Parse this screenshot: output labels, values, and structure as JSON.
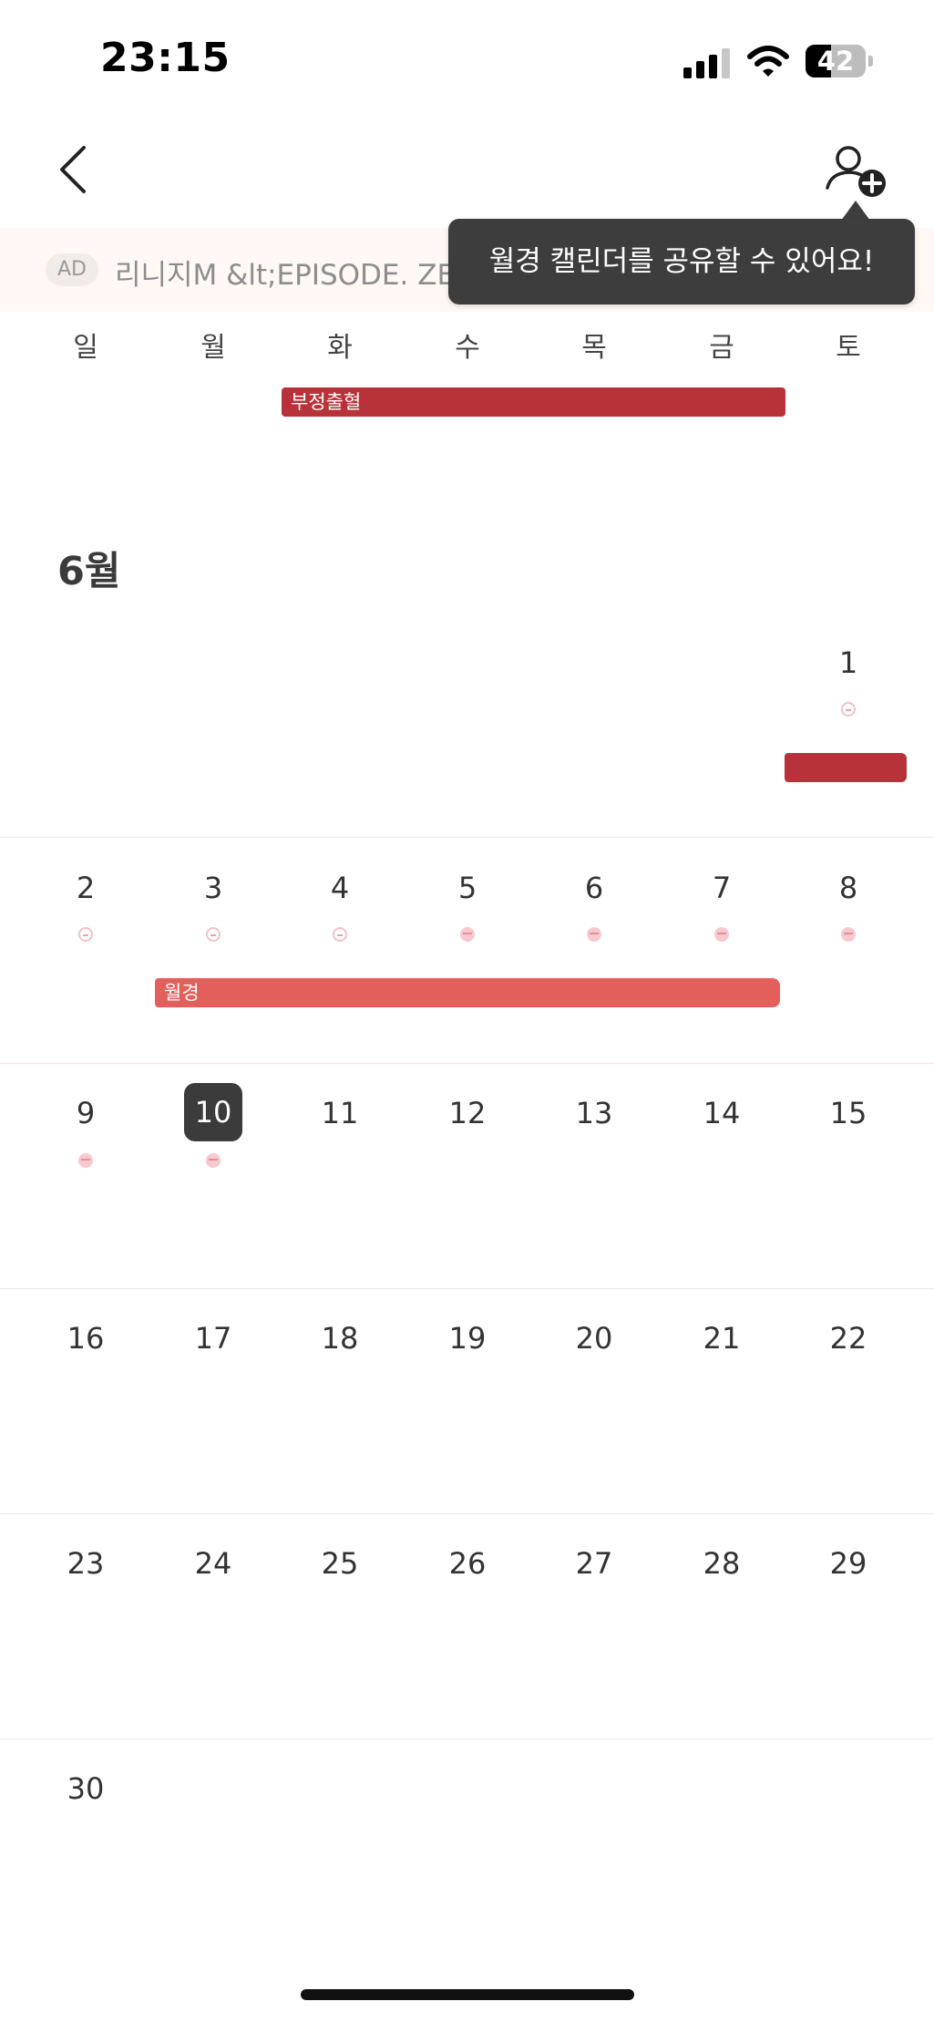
{
  "status_bar": {
    "time": "23:15",
    "battery_percent": "42",
    "battery_level": 0.42
  },
  "header": {
    "back_icon": "chevron-left-icon",
    "share_icon": "person-add-icon"
  },
  "ad": {
    "badge": "AD",
    "text": "리니지M &lt;EPISODE. ZE"
  },
  "tooltip": {
    "text": "월경 캘린더를 공유할 수 있어요!"
  },
  "weekdays": [
    "일",
    "월",
    "화",
    "수",
    "목",
    "금",
    "토"
  ],
  "prev_month_event": {
    "label": "부정출혈",
    "color": "#b73339"
  },
  "calendar": {
    "month_title": "6월",
    "row1": [
      "1"
    ],
    "row2": [
      "2",
      "3",
      "4",
      "5",
      "6",
      "7",
      "8"
    ],
    "row3": [
      "9",
      "10",
      "11",
      "12",
      "13",
      "14",
      "15"
    ],
    "row4": [
      "16",
      "17",
      "18",
      "19",
      "20",
      "21",
      "22"
    ],
    "row5": [
      "23",
      "24",
      "25",
      "26",
      "27",
      "28",
      "29"
    ],
    "row6": [
      "30"
    ],
    "today": "10",
    "period_event": {
      "label": "월경",
      "color": "#e35f5c"
    },
    "continued_event_color": "#b73339"
  }
}
